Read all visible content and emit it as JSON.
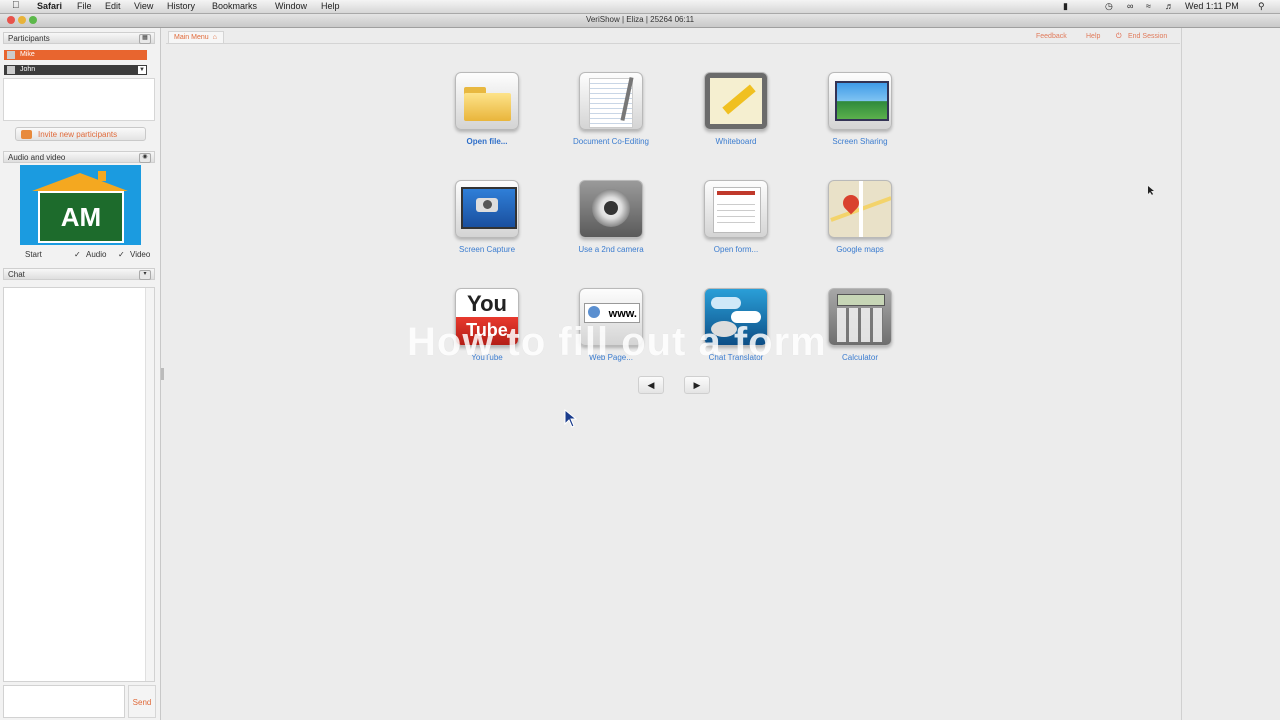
{
  "menubar": {
    "apple": "",
    "items": [
      "Safari",
      "File",
      "Edit",
      "View",
      "History",
      "Bookmarks",
      "Window",
      "Help"
    ],
    "clock": "Wed 1:11 PM"
  },
  "window": {
    "title": "VeriShow | Eliza | 25264 06:11"
  },
  "participants": {
    "header": "Participants",
    "list": [
      {
        "name": "Mike",
        "color": "#e8652f"
      },
      {
        "name": "John",
        "color": "#3c3c3c"
      }
    ],
    "invite_label": "Invite new participants"
  },
  "audio_video": {
    "header": "Audio and video",
    "logo_text": "AM",
    "start_label": "Start",
    "audio_label": "Audio",
    "video_label": "Video",
    "audio_checked": true,
    "video_checked": true
  },
  "chat": {
    "header": "Chat",
    "send_label": "Send"
  },
  "main": {
    "tab_label": "Main Menu",
    "top_links": [
      "Feedback",
      "Help",
      "End Session"
    ],
    "tiles": [
      {
        "label": "Open file...",
        "icon": "folder-icon",
        "bold": true
      },
      {
        "label": "Document Co-Editing",
        "icon": "notepad-icon"
      },
      {
        "label": "Whiteboard",
        "icon": "pencil-board-icon"
      },
      {
        "label": "Screen Sharing",
        "icon": "monitor-landscape-icon"
      },
      {
        "label": "Screen Capture",
        "icon": "camera-screen-icon"
      },
      {
        "label": "Use a 2nd camera",
        "icon": "webcam-icon"
      },
      {
        "label": "Open form...",
        "icon": "form-icon"
      },
      {
        "label": "Google maps",
        "icon": "map-pin-icon"
      },
      {
        "label": "YouTube",
        "icon": "youtube-icon"
      },
      {
        "label": "Web Page...",
        "icon": "www-icon"
      },
      {
        "label": "Chat Translator",
        "icon": "chat-bubbles-icon"
      },
      {
        "label": "Calculator",
        "icon": "calculator-icon"
      }
    ],
    "youtube_top": "You",
    "youtube_bottom": "Tube",
    "www_text": "www.",
    "caption": "How to fill out a form",
    "prev_label": "◀",
    "next_label": "▶"
  }
}
